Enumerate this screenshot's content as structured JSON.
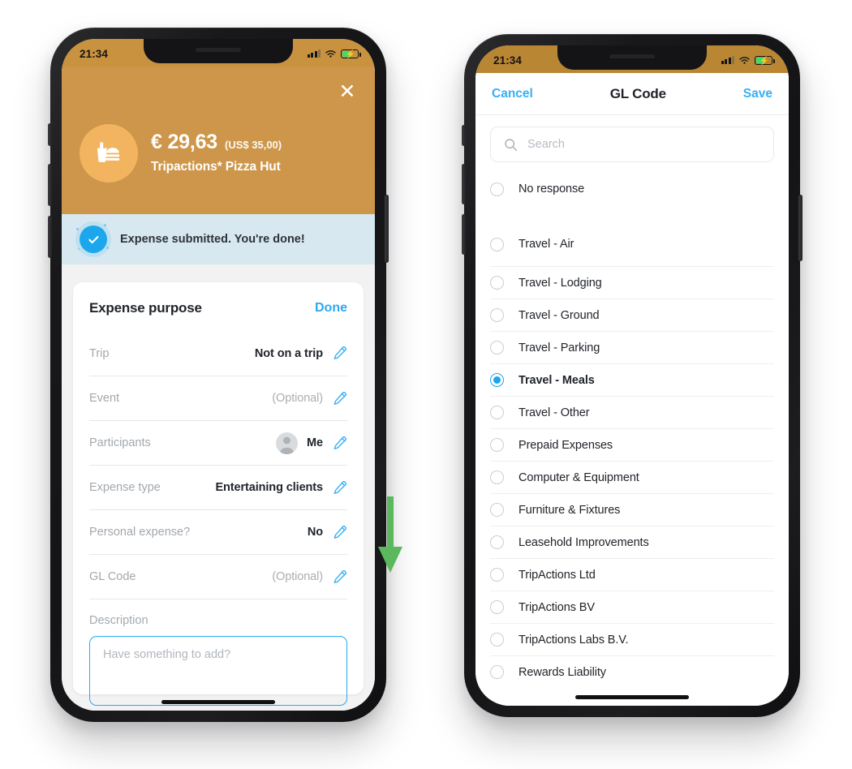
{
  "status_bar": {
    "time": "21:34",
    "signal_icon": "cellular-signal-icon",
    "wifi_icon": "wifi-icon",
    "battery_icon": "battery-charging-icon"
  },
  "left_phone": {
    "hero": {
      "close_label": "✕",
      "merchant_icon": "fast-food-icon",
      "amount": "€ 29,63",
      "amount_converted": "(US$ 35,00)",
      "merchant": "Tripactions* Pizza Hut",
      "background_color": "#ce964a"
    },
    "banner": {
      "icon": "check-circle-icon",
      "text": "Expense submitted. You're done!",
      "background_color": "#d7e8f0",
      "accent_color": "#1ca7ec"
    },
    "card": {
      "title": "Expense purpose",
      "done_label": "Done",
      "rows": [
        {
          "label": "Trip",
          "value": "Not on a trip",
          "muted": false,
          "avatar": false
        },
        {
          "label": "Event",
          "value": "(Optional)",
          "muted": true,
          "avatar": false
        },
        {
          "label": "Participants",
          "value": "Me",
          "muted": false,
          "avatar": true
        },
        {
          "label": "Expense type",
          "value": "Entertaining clients",
          "muted": false,
          "avatar": false
        },
        {
          "label": "Personal expense?",
          "value": "No",
          "muted": false,
          "avatar": false
        },
        {
          "label": "GL Code",
          "value": "(Optional)",
          "muted": true,
          "avatar": false
        }
      ],
      "description_label": "Description",
      "description_value": "",
      "description_placeholder": "Have something to add?"
    },
    "annotation": {
      "arrow_icon": "green-down-arrow-annotation",
      "color": "#5cb85c"
    }
  },
  "right_phone": {
    "nav": {
      "cancel_label": "Cancel",
      "title": "GL Code",
      "save_label": "Save",
      "link_color": "#37b0f4"
    },
    "search": {
      "icon": "search-icon",
      "value": "",
      "placeholder": "Search"
    },
    "options": [
      {
        "label": "No response",
        "selected": false,
        "group_start": true
      },
      {
        "label": "Travel - Air",
        "selected": false,
        "group_start": true
      },
      {
        "label": "Travel - Lodging",
        "selected": false,
        "group_start": false
      },
      {
        "label": "Travel - Ground",
        "selected": false,
        "group_start": false
      },
      {
        "label": "Travel - Parking",
        "selected": false,
        "group_start": false
      },
      {
        "label": "Travel - Meals",
        "selected": true,
        "group_start": false
      },
      {
        "label": "Travel - Other",
        "selected": false,
        "group_start": false
      },
      {
        "label": "Prepaid Expenses",
        "selected": false,
        "group_start": false
      },
      {
        "label": "Computer & Equipment",
        "selected": false,
        "group_start": false
      },
      {
        "label": "Furniture & Fixtures",
        "selected": false,
        "group_start": false
      },
      {
        "label": "Leasehold Improvements",
        "selected": false,
        "group_start": false
      },
      {
        "label": "TripActions Ltd",
        "selected": false,
        "group_start": false
      },
      {
        "label": "TripActions BV",
        "selected": false,
        "group_start": false
      },
      {
        "label": "TripActions Labs B.V.",
        "selected": false,
        "group_start": false
      },
      {
        "label": "Rewards Liability",
        "selected": false,
        "group_start": false
      }
    ],
    "selected_option": "Travel - Meals",
    "accent_color": "#1ca7ec"
  }
}
